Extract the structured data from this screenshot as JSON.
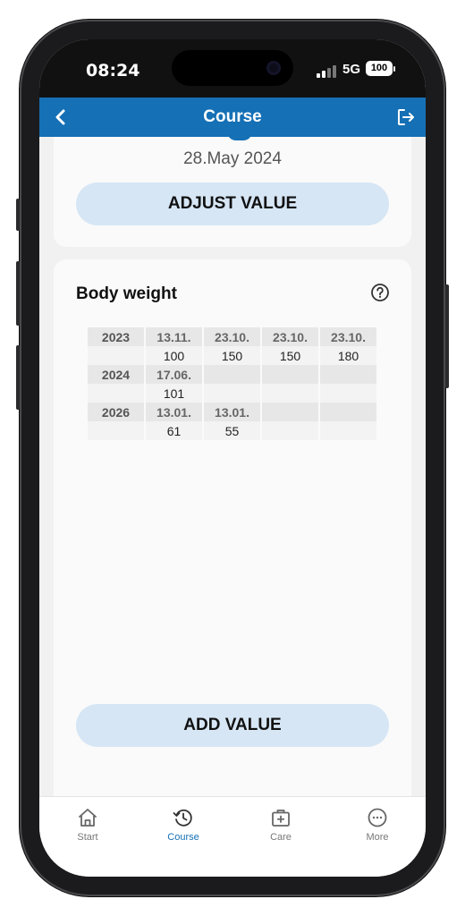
{
  "status_bar": {
    "time": "08:24",
    "network": "5G",
    "battery": "100"
  },
  "header": {
    "title": "Course",
    "back_icon": "chevron-left-icon",
    "logout_icon": "logout-icon"
  },
  "previous_card": {
    "date": "28.May 2024",
    "button_label": "ADJUST VALUE"
  },
  "body_weight_card": {
    "title": "Body weight",
    "help_icon": "help-circle-icon",
    "rows": [
      {
        "year": "2023",
        "dates": [
          "13.11.",
          "23.10.",
          "23.10.",
          "23.10."
        ],
        "values": [
          "100",
          "150",
          "150",
          "180"
        ]
      },
      {
        "year": "2024",
        "dates": [
          "17.06.",
          "",
          "",
          ""
        ],
        "values": [
          "101",
          "",
          "",
          ""
        ]
      },
      {
        "year": "2026",
        "dates": [
          "13.01.",
          "13.01.",
          "",
          ""
        ],
        "values": [
          "61",
          "55",
          "",
          ""
        ]
      }
    ],
    "button_label": "ADD VALUE"
  },
  "tabs": [
    {
      "label": "Start",
      "icon": "home-icon",
      "active": false
    },
    {
      "label": "Course",
      "icon": "history-icon",
      "active": true
    },
    {
      "label": "Care",
      "icon": "medical-bag-icon",
      "active": false
    },
    {
      "label": "More",
      "icon": "more-icon",
      "active": false
    }
  ],
  "colors": {
    "accent": "#1570b5",
    "button_bg": "#d6e6f5",
    "background": "#f1f1f1"
  }
}
